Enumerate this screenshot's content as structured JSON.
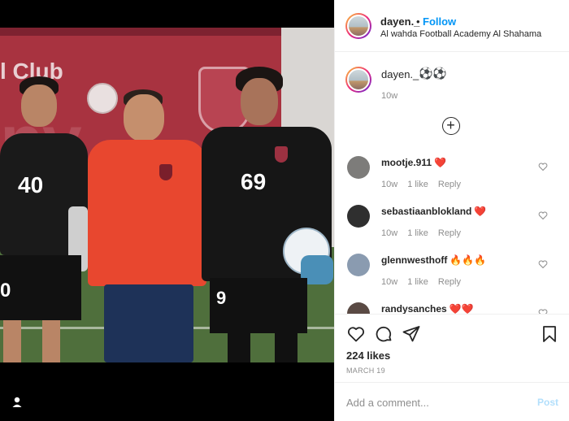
{
  "post": {
    "author": "dayen._",
    "follow_label": "Follow",
    "separator": "•",
    "location": "Al wahda Football Academy Al Shahama",
    "caption_emoji": "⚽⚽",
    "caption_time": "10w",
    "likes": "224 likes",
    "date": "MARCH 19"
  },
  "photo": {
    "banner_text": "l Club",
    "banner_big": "ny",
    "jersey_numbers": [
      "40",
      "69",
      "9",
      "0"
    ]
  },
  "comments": [
    {
      "user": "mootje.911",
      "text": "❤️",
      "time": "10w",
      "likes": "1 like",
      "reply": "Reply",
      "avatar_color": "#7d7c7a"
    },
    {
      "user": "sebastiaanblokland",
      "text": "❤️",
      "time": "10w",
      "likes": "1 like",
      "reply": "Reply",
      "avatar_color": "#2f2f2f"
    },
    {
      "user": "glennwesthoff",
      "text": "🔥🔥🔥",
      "time": "10w",
      "likes": "1 like",
      "reply": "Reply",
      "avatar_color": "#8a9bb0"
    },
    {
      "user": "randysanches",
      "text": "❤️❤️",
      "time": "",
      "likes": "",
      "reply": "",
      "avatar_color": "#5a4a44"
    }
  ],
  "add_comment": {
    "placeholder": "Add a comment...",
    "post_label": "Post"
  },
  "icons": {
    "load_more": "plus-circle-icon",
    "like": "heart-outline-icon",
    "comment": "comment-bubble-icon",
    "share": "paper-plane-icon",
    "save": "bookmark-icon",
    "user": "user-silhouette-icon"
  },
  "colors": {
    "accent": "#0095f6",
    "post_disabled": "#b2dffc",
    "muted": "#8e8e8e"
  }
}
